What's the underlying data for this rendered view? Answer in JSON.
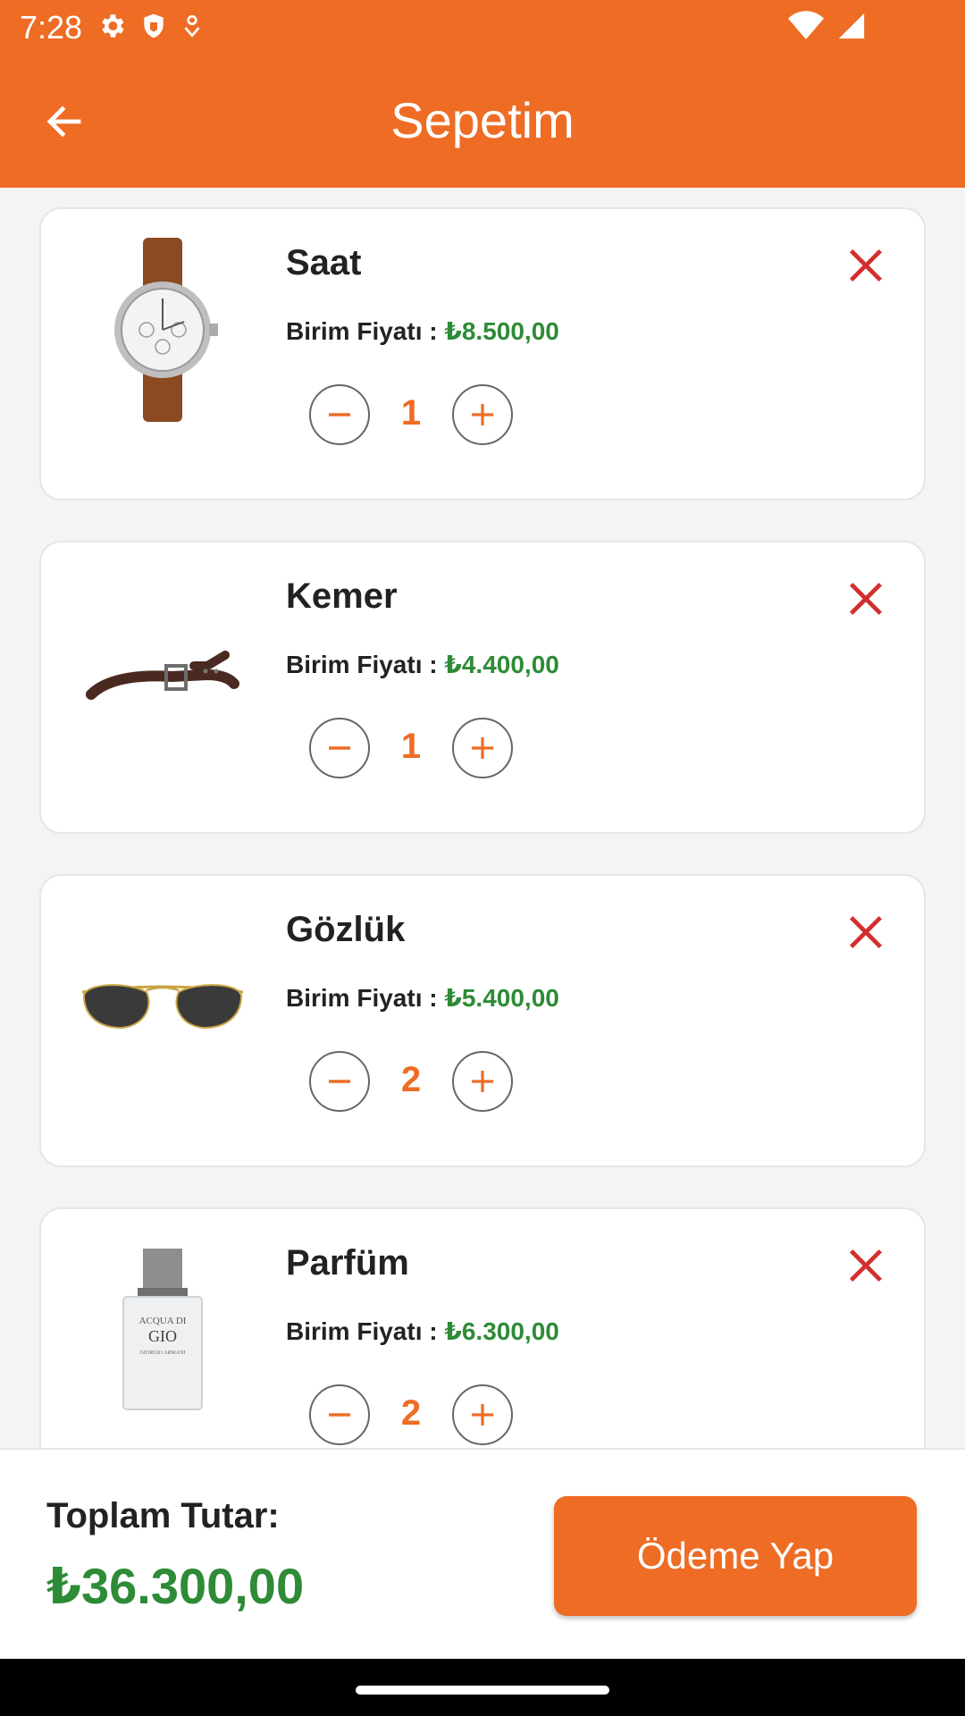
{
  "status_bar": {
    "time": "7:28",
    "left_icons": [
      "gear-icon",
      "shield-icon",
      "location-pin-icon"
    ],
    "right_icons": [
      "wifi-icon",
      "signal-icon"
    ]
  },
  "app_bar": {
    "title": "Sepetim",
    "back_icon": "arrow-left-icon",
    "color": "#ee6c24"
  },
  "cart": {
    "price_label": "Birim Fiyatı : ",
    "items": [
      {
        "name": "Saat",
        "price": "₺8.500,00",
        "quantity": "1",
        "image": "watch-image"
      },
      {
        "name": "Kemer",
        "price": "₺4.400,00",
        "quantity": "1",
        "image": "belt-image"
      },
      {
        "name": "Gözlük",
        "price": "₺5.400,00",
        "quantity": "2",
        "image": "sunglasses-image"
      },
      {
        "name": "Parfüm",
        "price": "₺6.300,00",
        "quantity": "2",
        "image": "perfume-image"
      }
    ]
  },
  "footer": {
    "total_label": "Toplam Tutar:",
    "total_value": "₺36.300,00",
    "pay_label": "Ödeme Yap"
  },
  "perfume_label": {
    "line1": "ACQUA DI",
    "line2": "GIO",
    "line3": "GIORGIO ARMANI"
  },
  "colors": {
    "accent": "#ee6c24",
    "price": "#2e8b36",
    "remove": "#d32f2f"
  }
}
